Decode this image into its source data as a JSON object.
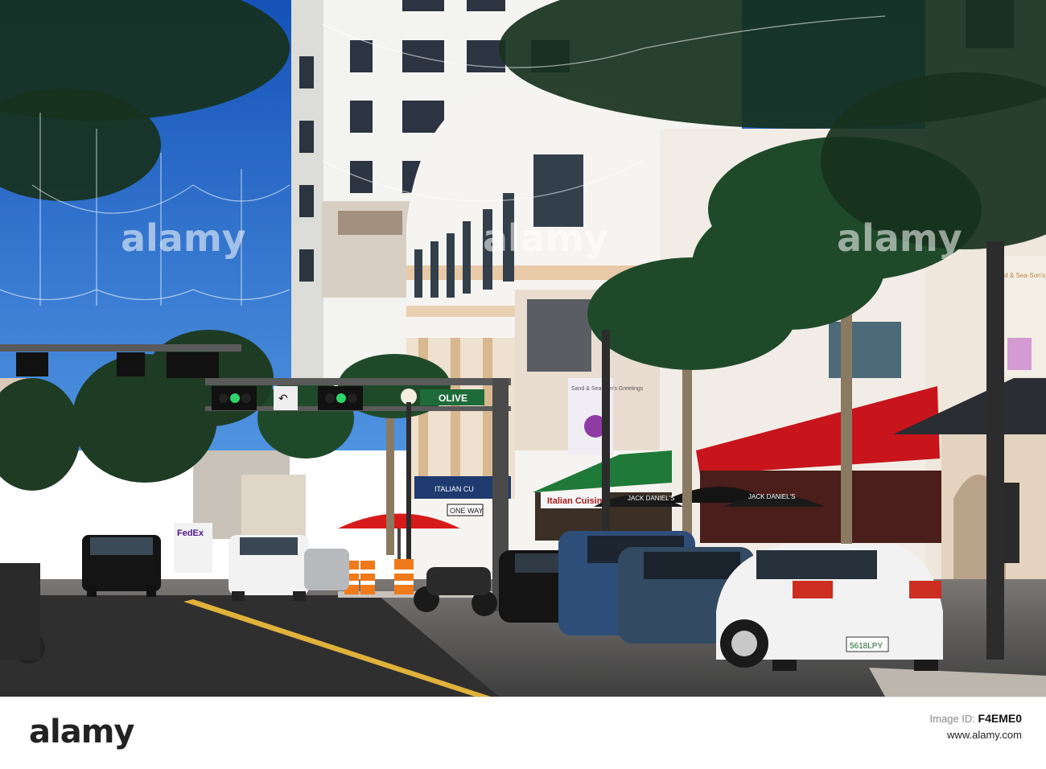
{
  "footer": {
    "logo_text": "alamy",
    "image_id_label": "Image ID:",
    "image_id": "F4EME0",
    "site_label": "www.alamy.com"
  },
  "watermarks": [
    "alamy",
    "alamy",
    "alamy"
  ],
  "street_signs": {
    "street_name": "OLIVE",
    "one_way": "ONE WAY",
    "fedex": "FedEx"
  },
  "banners": {
    "left_banner": "Sand & Sea-Son's Greetings",
    "right_banner": "Sand & Sea-Son's Greetings"
  },
  "storefront_text": {
    "italian": "Italian Cuisine",
    "umbrella": "JACK DANIEL'S"
  },
  "plate": "5618LPY",
  "colors": {
    "sky": "#1d63c9",
    "awning_red": "#c8141b",
    "awning_green": "#1f7a3a",
    "road": "#4a4a4a",
    "white_car": "#f2f2f2"
  }
}
